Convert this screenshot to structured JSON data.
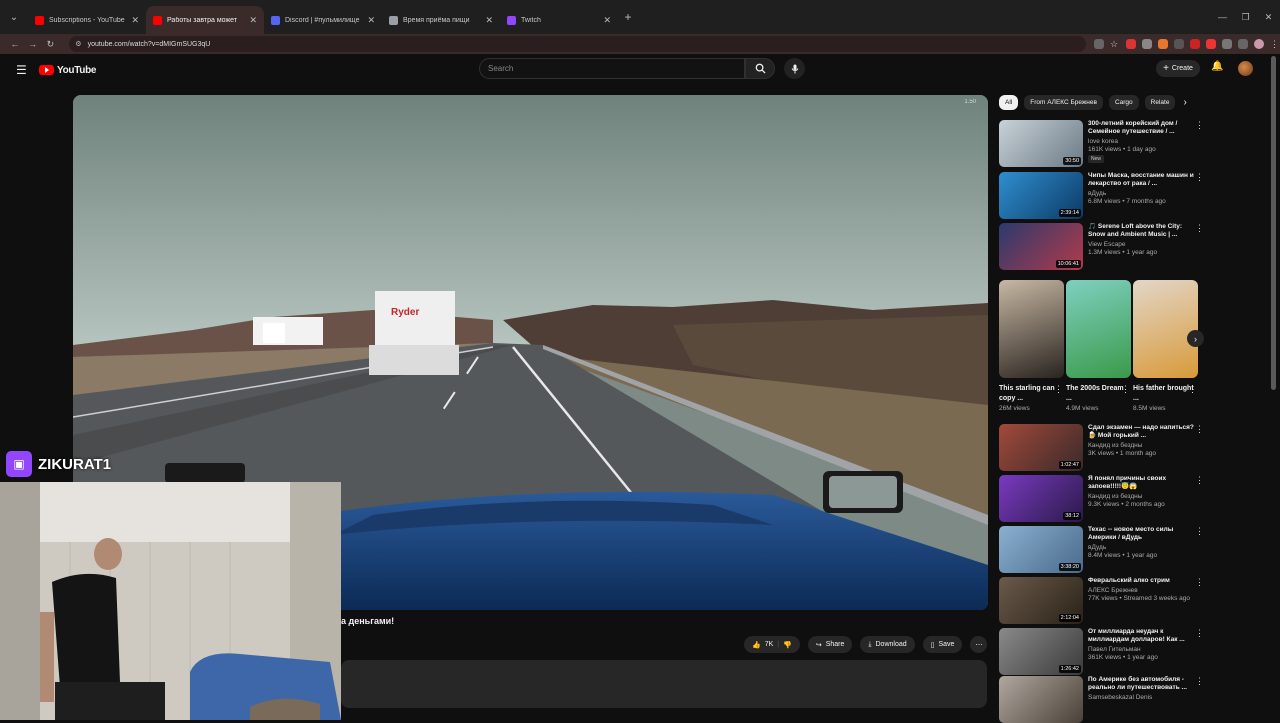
{
  "browser": {
    "tabs": [
      {
        "title": "Subscriptions - YouTube",
        "color": "#ff0000",
        "active": false
      },
      {
        "title": "Работы завтра может",
        "color": "#ff0000",
        "active": true
      },
      {
        "title": "Discord | #пульмилище | l'affaire",
        "color": "#5865f2",
        "active": false
      },
      {
        "title": "Время приёма пищи",
        "color": "#9aa0a6",
        "active": false
      },
      {
        "title": "Twitch",
        "color": "#9146ff",
        "active": false
      }
    ],
    "url": "youtube.com/watch?v=dMIGmSUG3qU"
  },
  "yt": {
    "logo_text": "YouTube",
    "search_placeholder": "Search",
    "create_label": "Create"
  },
  "video": {
    "speed_label": "1.50",
    "title_fragment": "а деньгами!",
    "likes": "7K",
    "share_label": "Share",
    "download_label": "Download",
    "save_label": "Save"
  },
  "overlay": {
    "streamer_name": "ZIKURAT1"
  },
  "chips": [
    "All",
    "From АЛЕКС Брежнев",
    "Cargo",
    "Relate"
  ],
  "recs_top": [
    {
      "title": "300-летний корейский дом / Семейное путешествие / ...",
      "channel": "love korea",
      "meta": "161K views • 1 day ago",
      "duration": "30:50",
      "badge": "New",
      "color1": "#c9d2d8",
      "color2": "#6b7a86"
    },
    {
      "title": "Чипы Маска, восстание машин и лекарство от рака / ...",
      "channel": "вДудь",
      "meta": "6.8M views • 7 months ago",
      "duration": "2:39:14",
      "badge": "",
      "color1": "#2f8fd0",
      "color2": "#0c3a66"
    },
    {
      "title": "🎵 Serene Loft above the City: Snow and Ambient Music | ...",
      "channel": "View Escape",
      "meta": "1.3M views • 1 year ago",
      "duration": "10:06:41",
      "badge": "",
      "color1": "#2b3a6e",
      "color2": "#b23a4a"
    }
  ],
  "shorts": [
    {
      "title": "This starling can copy ...",
      "views": "26M views",
      "color1": "#c8b8a4",
      "color2": "#2a2420"
    },
    {
      "title": "The 2000s Dream ...",
      "views": "4.9M views",
      "color1": "#7fd0c0",
      "color2": "#3a9a4a"
    },
    {
      "title": "His father brought ...",
      "views": "8.5M views",
      "color1": "#e2d6c8",
      "color2": "#d89a3a"
    }
  ],
  "recs_bottom": [
    {
      "title": "Сдал экзамен — надо напиться?🍺 Мой горький ...",
      "channel": "Кандид из бездны",
      "meta": "3K views • 1 month ago",
      "duration": "1:02:47",
      "color1": "#a2493a",
      "color2": "#3a2a2a"
    },
    {
      "title": "Я понял причины своих запоев!!!!!😇😱",
      "channel": "Кандид из бездны",
      "meta": "9.3K views • 2 months ago",
      "duration": "38:12",
      "color1": "#7a3ac0",
      "color2": "#2a1a4a"
    },
    {
      "title": "Техас -- новое место силы Америки / вДудь",
      "channel": "вДудь",
      "meta": "8.4M views • 1 year ago",
      "duration": "3:38:20",
      "color1": "#8ab0d0",
      "color2": "#4a6a8a"
    },
    {
      "title": "Февральский алко стрим",
      "channel": "АЛЕКС Брежнев",
      "meta": "77K views • Streamed 3 weeks ago",
      "duration": "2:12:04",
      "color1": "#6a5a4a",
      "color2": "#2a2218"
    },
    {
      "title": "От миллиарда неудач к миллиардам долларов! Как ...",
      "channel": "Павел Гительман",
      "meta": "361K views • 1 year ago",
      "duration": "1:26:42",
      "color1": "#8a8a8a",
      "color2": "#3a3a3a"
    },
    {
      "title": "По Америке без автомобиля - реально ли путешествовать ...",
      "channel": "Samsebeskazal Denis",
      "meta": "",
      "duration": "",
      "color1": "#b0a8a0",
      "color2": "#4a4038"
    }
  ]
}
